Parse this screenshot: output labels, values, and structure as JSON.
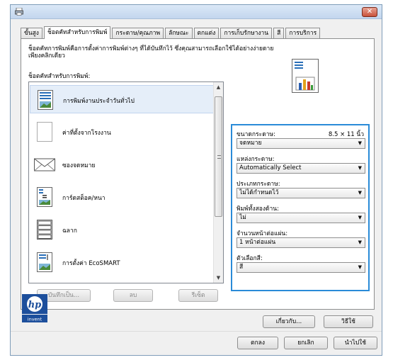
{
  "window": {
    "close_label": "✕"
  },
  "tabs": [
    {
      "label": "ขั้นสูง"
    },
    {
      "label": "ช็อตคัทสำหรับการพิมพ์"
    },
    {
      "label": "กระดาษ/คุณภาพ"
    },
    {
      "label": "ลักษณะ"
    },
    {
      "label": "ตกแต่ง"
    },
    {
      "label": "การเก็บรักษางาน"
    },
    {
      "label": "สี"
    },
    {
      "label": "การบริการ"
    }
  ],
  "panel": {
    "description": "ช็อตคัทการพิมพ์คือการตั้งค่าการพิมพ์ต่างๆ ที่ได้บันทึกไว้ ซึ่งคุณสามารถเลือกใช้ได้อย่างง่ายดายเพียงคลิกเดียว",
    "list_label": "ช็อตคัทสำหรับการพิมพ์:"
  },
  "shortcuts": [
    {
      "label": "การพิมพ์งานประจำวันทั่วไป",
      "icon": "everyday-print-icon"
    },
    {
      "label": "ค่าที่ตั้งจากโรงงาน",
      "icon": "factory-defaults-icon"
    },
    {
      "label": "ซองจดหมาย",
      "icon": "envelope-icon"
    },
    {
      "label": "การ์ดสต็อค/หนา",
      "icon": "cardstock-icon"
    },
    {
      "label": "ฉลาก",
      "icon": "labels-icon"
    },
    {
      "label": "การตั้งค่า EcoSMART",
      "icon": "ecosmart-icon"
    }
  ],
  "list_buttons": {
    "save_as": "บันทึกเป็น...",
    "delete": "ลบ",
    "reset": "รีเซ็ต"
  },
  "properties": {
    "paper_size_label": "ขนาดกระดาษ:",
    "paper_size_value": "8.5 × 11 นิ้ว",
    "paper_size_select": "จดหมาย",
    "paper_source_label": "แหล่งกระดาษ:",
    "paper_source_select": "Automatically Select",
    "paper_type_label": "ประเภทกระดาษ:",
    "paper_type_select": "ไม่ได้กำหนดไว้",
    "duplex_label": "พิมพ์ทั้งสองด้าน:",
    "duplex_select": "ไม่",
    "pages_per_sheet_label": "จำนวนหน้าต่อแผ่น:",
    "pages_per_sheet_select": "1 หน้าต่อแผ่น",
    "color_label": "ตัวเลือกสี:",
    "color_select": "สี"
  },
  "footer": {
    "logo_text": "invent",
    "about": "เกี่ยวกับ...",
    "help": "วิธีใช้",
    "ok": "ตกลง",
    "cancel": "ยกเลิก",
    "apply": "นำไปใช้"
  },
  "colors": {
    "accent": "#2a8bd8",
    "close": "#c9523b"
  }
}
